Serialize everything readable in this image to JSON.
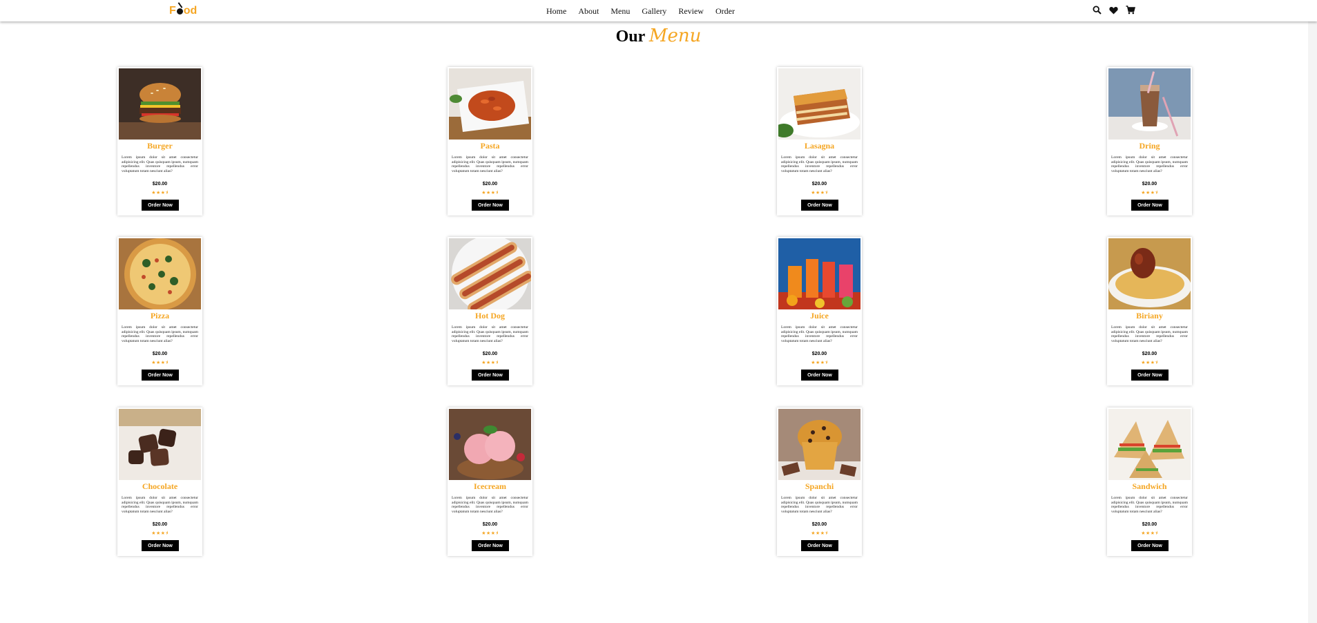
{
  "header": {
    "logo": {
      "pre": "F",
      "post": "od"
    },
    "nav": [
      "Home",
      "About",
      "Menu",
      "Gallery",
      "Review",
      "Order"
    ],
    "icons": [
      "search-icon",
      "heart-icon",
      "cart-icon"
    ]
  },
  "heading": {
    "first": "Our",
    "second": "Menu"
  },
  "menu": [
    {
      "name": "Burger",
      "desc": "Lorem ipsum dolor sit amet consectetur adipisicing elit. Quas quisquam ipsum, numquam repellendus inventore repellendus error voluptatum totam nesciunt alias?",
      "price": "$20.00",
      "stars": "★★★⯨",
      "button": "Order Now"
    },
    {
      "name": "Pasta",
      "desc": "Lorem ipsum dolor sit amet consectetur adipisicing elit. Quas quisquam ipsum, numquam repellendus inventore repellendus error voluptatum totam nesciunt alias?",
      "price": "$20.00",
      "stars": "★★★⯨",
      "button": "Order Now"
    },
    {
      "name": "Lasagna",
      "desc": "Lorem ipsum dolor sit amet consectetur adipisicing elit. Quas quisquam ipsum, numquam repellendus inventore repellendus error voluptatum totam nesciunt alias?",
      "price": "$20.00",
      "stars": "★★★⯨",
      "button": "Order Now"
    },
    {
      "name": "Dring",
      "desc": "Lorem ipsum dolor sit amet consectetur adipisicing elit. Quas quisquam ipsum, numquam repellendus inventore repellendus error voluptatum totam nesciunt alias?",
      "price": "$20.00",
      "stars": "★★★⯨",
      "button": "Order Now"
    },
    {
      "name": "Pizza",
      "desc": "Lorem ipsum dolor sit amet consectetur adipisicing elit. Quas quisquam ipsum, numquam repellendus inventore repellendus error voluptatum totam nesciunt alias?",
      "price": "$20.00",
      "stars": "★★★⯨",
      "button": "Order Now"
    },
    {
      "name": "Hot Dog",
      "desc": "Lorem ipsum dolor sit amet consectetur adipisicing elit. Quas quisquam ipsum, numquam repellendus inventore repellendus error voluptatum totam nesciunt alias?",
      "price": "$20.00",
      "stars": "★★★⯨",
      "button": "Order Now"
    },
    {
      "name": "Juice",
      "desc": "Lorem ipsum dolor sit amet consectetur adipisicing elit. Quas quisquam ipsum, numquam repellendus inventore repellendus error voluptatum totam nesciunt alias?",
      "price": "$20.00",
      "stars": "★★★⯨",
      "button": "Order Now"
    },
    {
      "name": "Biriany",
      "desc": "Lorem ipsum dolor sit amet consectetur adipisicing elit. Quas quisquam ipsum, numquam repellendus inventore repellendus error voluptatum totam nesciunt alias?",
      "price": "$20.00",
      "stars": "★★★⯨",
      "button": "Order Now"
    },
    {
      "name": "Chocolate",
      "desc": "Lorem ipsum dolor sit amet consectetur adipisicing elit. Quas quisquam ipsum, numquam repellendus inventore repellendus error voluptatum totam nesciunt alias?",
      "price": "$20.00",
      "stars": "★★★⯨",
      "button": "Order Now"
    },
    {
      "name": "Icecream",
      "desc": "Lorem ipsum dolor sit amet consectetur adipisicing elit. Quas quisquam ipsum, numquam repellendus inventore repellendus error voluptatum totam nesciunt alias?",
      "price": "$20.00",
      "stars": "★★★⯨",
      "button": "Order Now"
    },
    {
      "name": "Spanchi",
      "desc": "Lorem ipsum dolor sit amet consectetur adipisicing elit. Quas quisquam ipsum, numquam repellendus inventore repellendus error voluptatum totam nesciunt alias?",
      "price": "$20.00",
      "stars": "★★★⯨",
      "button": "Order Now"
    },
    {
      "name": "Sandwich",
      "desc": "Lorem ipsum dolor sit amet consectetur adipisicing elit. Quas quisquam ipsum, numquam repellendus inventore repellendus error voluptatum totam nesciunt alias?",
      "price": "$20.00",
      "stars": "★★★⯨",
      "button": "Order Now"
    }
  ],
  "colors": {
    "accent": "#f5a623",
    "button": "#000000"
  }
}
